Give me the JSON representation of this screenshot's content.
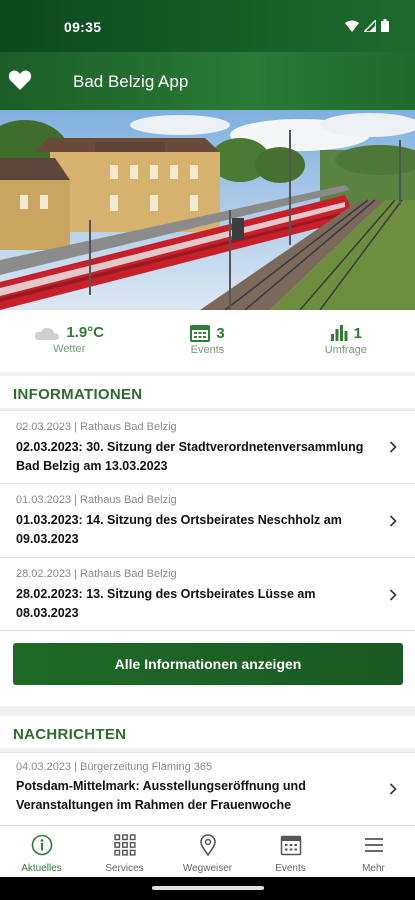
{
  "status_bar": {
    "time": "09:35"
  },
  "app_bar": {
    "title": "Bad Belzig App",
    "accent": "#1b5e27"
  },
  "hero": {
    "image": "train-station-photo"
  },
  "stats": [
    {
      "icon": "cloud-icon",
      "value": "1.9°C",
      "label": "Wetter"
    },
    {
      "icon": "calendar-icon",
      "value": "3",
      "label": "Events"
    },
    {
      "icon": "bar-chart-icon",
      "value": "1",
      "label": "Umfrage"
    }
  ],
  "informationen": {
    "heading": "INFORMATIONEN",
    "items": [
      {
        "meta": "02.03.2023 | Rathaus Bad Belzig",
        "title": "02.03.2023: 30. Sitzung der Stadtverordnetenversammlung Bad Belzig am 13.03.2023"
      },
      {
        "meta": "01.03.2023 | Rathaus Bad Belzig",
        "title": "01.03.2023: 14. Sitzung des Ortsbeirates Neschholz am 09.03.2023"
      },
      {
        "meta": "28.02.2023 | Rathaus Bad Belzig",
        "title": "28.02.2023: 13. Sitzung des Ortsbeirates Lüsse am 08.03.2023"
      }
    ],
    "button_label": "Alle Informationen anzeigen"
  },
  "nachrichten": {
    "heading": "NACHRICHTEN",
    "items": [
      {
        "meta": "04.03.2023 | Bürgerzeitung Fläming 365",
        "title": "Potsdam-Mittelmark: Ausstellungseröffnung und Veranstaltungen im Rahmen der Frauenwoche"
      }
    ]
  },
  "bottom_nav": [
    {
      "icon": "info-icon",
      "label": "Aktuelles",
      "active": true
    },
    {
      "icon": "grid-icon",
      "label": "Services",
      "active": false
    },
    {
      "icon": "location-pin-icon",
      "label": "Wegweiser",
      "active": false
    },
    {
      "icon": "calendar-icon",
      "label": "Events",
      "active": false
    },
    {
      "icon": "menu-icon",
      "label": "Mehr",
      "active": false
    }
  ]
}
